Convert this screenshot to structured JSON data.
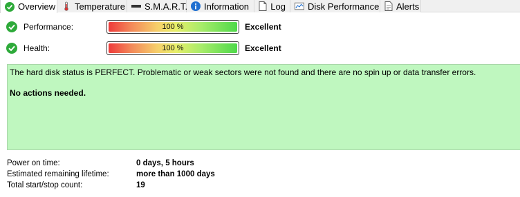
{
  "tabs": [
    {
      "label": "Overview",
      "icon": "check-circle-icon",
      "active": true
    },
    {
      "label": "Temperature",
      "icon": "thermometer-icon",
      "active": false
    },
    {
      "label": "S.M.A.R.T.",
      "icon": "drive-bar-icon",
      "active": false
    },
    {
      "label": "Information",
      "icon": "info-icon",
      "active": false
    },
    {
      "label": "Log",
      "icon": "document-icon",
      "active": false
    },
    {
      "label": "Disk Performance",
      "icon": "chart-icon",
      "active": false
    },
    {
      "label": "Alerts",
      "icon": "alert-document-icon",
      "active": false
    }
  ],
  "performance": {
    "label": "Performance:",
    "value_text": "100 %",
    "value_fraction": 1.0,
    "rating": "Excellent"
  },
  "health": {
    "label": "Health:",
    "value_text": "100 %",
    "value_fraction": 1.0,
    "rating": "Excellent"
  },
  "status": {
    "message": "The hard disk status is PERFECT. Problematic or weak sectors were not found and there are no spin up or data transfer errors.",
    "action": "No actions needed."
  },
  "stats": {
    "power_on_label": "Power on time:",
    "power_on_value": "0 days, 5 hours",
    "lifetime_label": "Estimated remaining lifetime:",
    "lifetime_value": "more than 1000 days",
    "startstop_label": "Total start/stop count:",
    "startstop_value": "19"
  },
  "colors": {
    "ok_green": "#2eaa3a",
    "status_bg": "#bff7bf",
    "info_blue": "#1f6fd0"
  }
}
